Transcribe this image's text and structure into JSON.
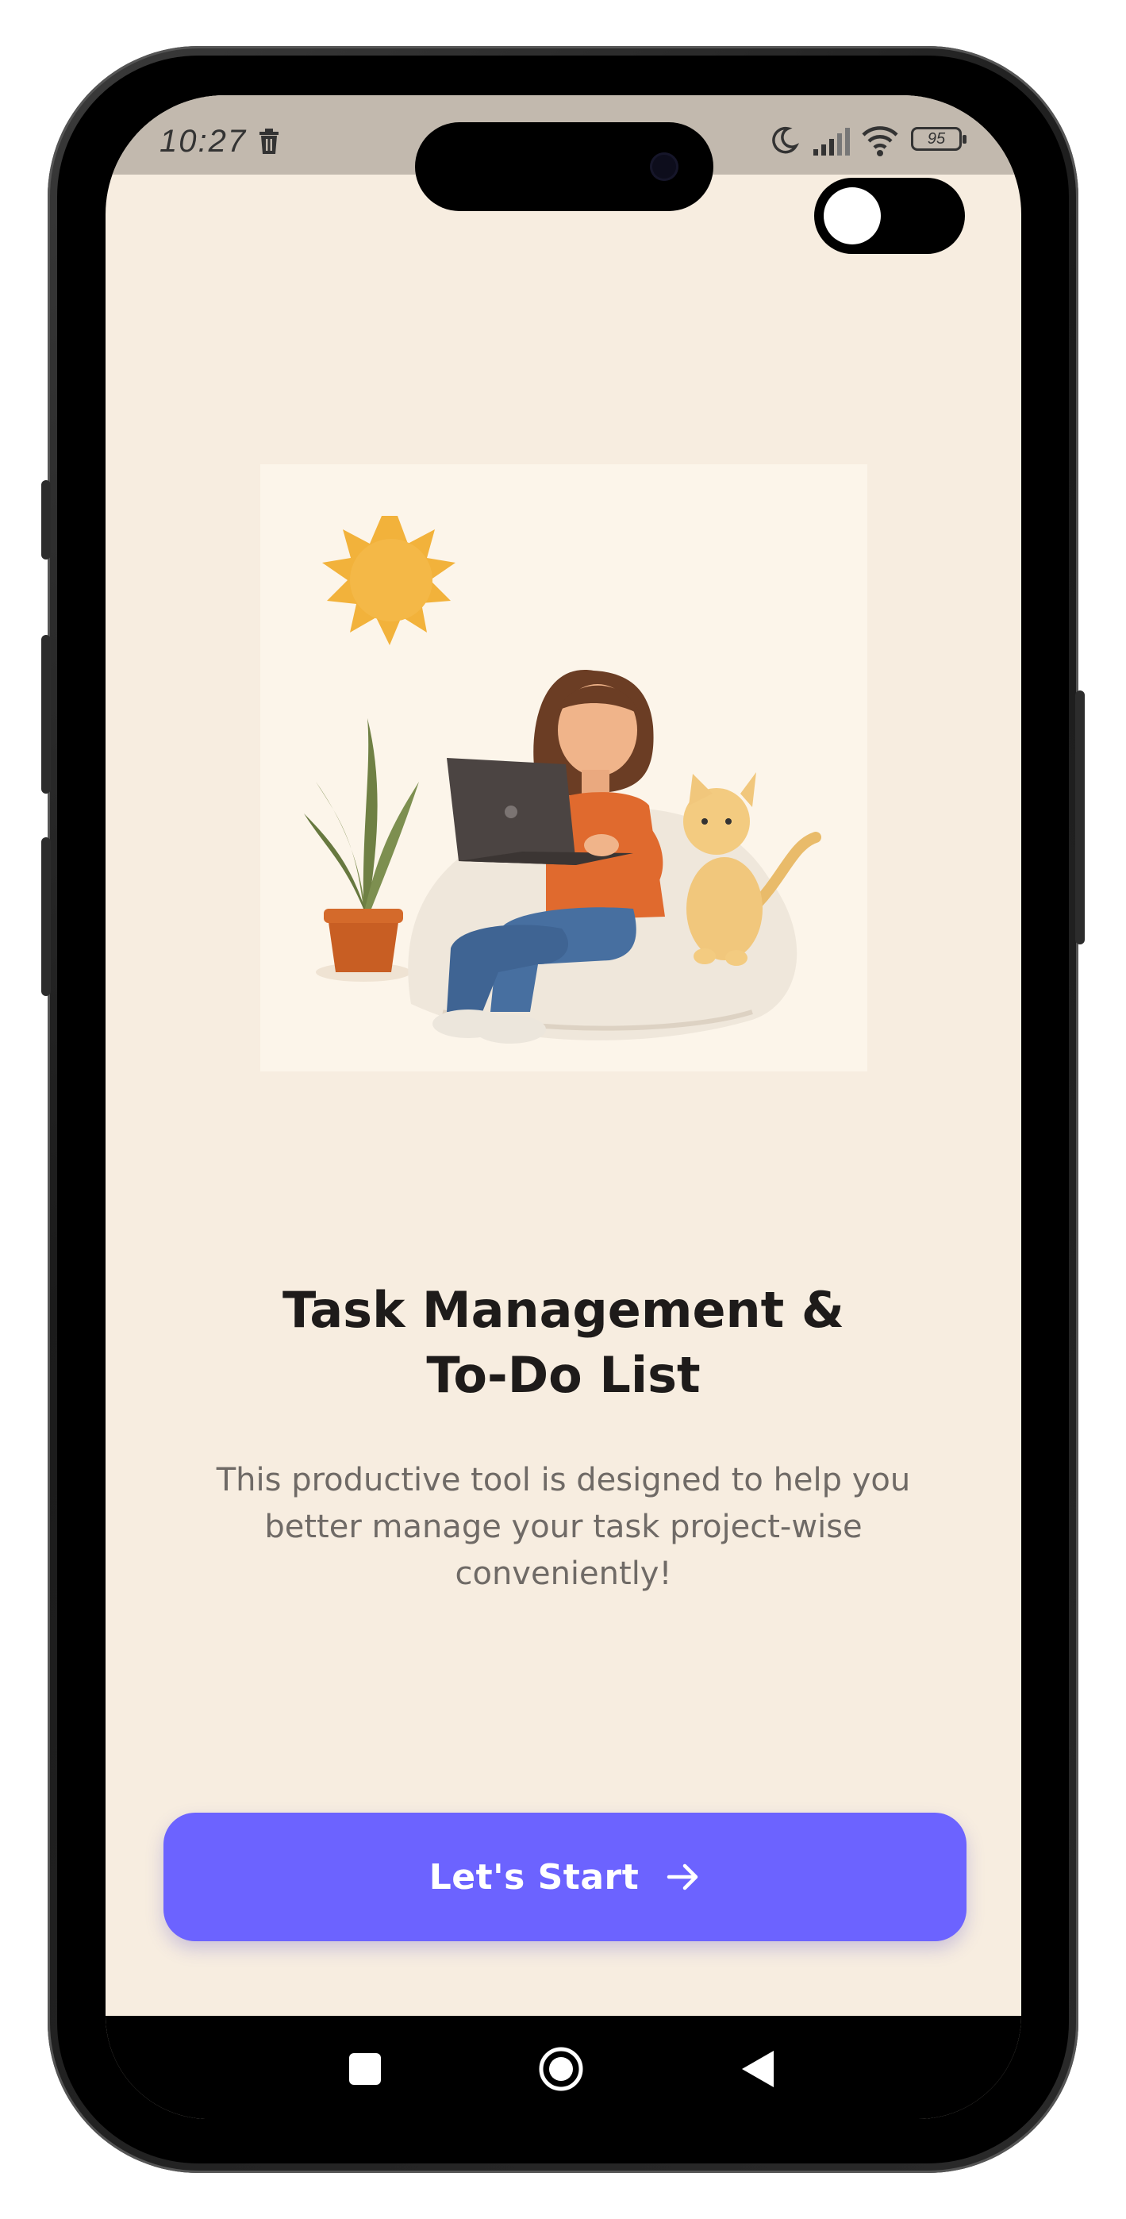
{
  "status_bar": {
    "time": "10:27",
    "battery": "95",
    "icons": [
      "trash-icon",
      "moon-icon",
      "signal-icon",
      "wifi-icon",
      "battery-icon"
    ]
  },
  "theme_toggle": {
    "icon": "toggle-switch"
  },
  "onboarding": {
    "title_line1": "Task Management &",
    "title_line2": "To-Do List",
    "subtitle_line1": "This productive tool is designed to help you",
    "subtitle_line2": "better manage your task project-wise",
    "subtitle_line3": "conveniently!",
    "start_button_label": "Let's Start",
    "start_button_icon": "arrow-right-icon"
  },
  "nav_bar": {
    "icons": [
      "recents-square-icon",
      "home-circle-icon",
      "back-triangle-icon"
    ]
  },
  "colors": {
    "background": "#f7ede0",
    "accent": "#6c63ff",
    "title": "#1e1b1a",
    "subtitle": "#6f6a66",
    "status_bar": "#c2b9ae"
  }
}
